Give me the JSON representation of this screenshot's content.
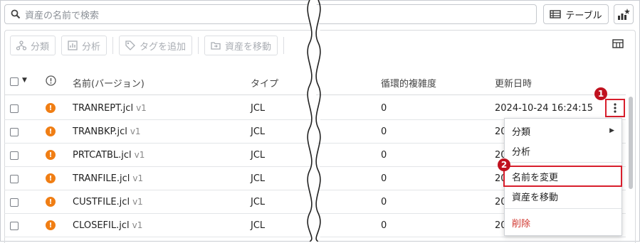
{
  "search": {
    "placeholder": "資産の名前で検索"
  },
  "header_buttons": {
    "table_label": "テーブル"
  },
  "toolbar": [
    {
      "label": "分類",
      "icon": "classify-icon"
    },
    {
      "label": "分析",
      "icon": "analyze-icon"
    },
    {
      "label": "タグを追加",
      "icon": "tag-icon"
    },
    {
      "label": "資産を移動",
      "icon": "move-icon"
    }
  ],
  "columns": {
    "name": "名前(バージョン)",
    "type": "タイプ",
    "complexity": "循環的複雑度",
    "updated": "更新日時"
  },
  "rows": [
    {
      "name": "TRANREPT.jcl",
      "version": "v1",
      "type": "JCL",
      "complexity": "0",
      "updated": "2024-10-24 16:24:15"
    },
    {
      "name": "TRANBKP.jcl",
      "version": "v1",
      "type": "JCL",
      "complexity": "0",
      "updated": "202"
    },
    {
      "name": "PRTCATBL.jcl",
      "version": "v1",
      "type": "JCL",
      "complexity": "0",
      "updated": "202"
    },
    {
      "name": "TRANFILE.jcl",
      "version": "v1",
      "type": "JCL",
      "complexity": "0",
      "updated": "202"
    },
    {
      "name": "CUSTFILE.jcl",
      "version": "v1",
      "type": "JCL",
      "complexity": "0",
      "updated": "202"
    },
    {
      "name": "CLOSEFIL.jcl",
      "version": "v1",
      "type": "JCL",
      "complexity": "0",
      "updated": "202"
    }
  ],
  "menu": {
    "classify": "分類",
    "analyze": "分析",
    "rename": "名前を変更",
    "move": "資産を移動",
    "delete": "削除"
  },
  "markers": {
    "one": "1",
    "two": "2"
  },
  "colors": {
    "warning": "#f07e14",
    "highlight": "#d81e2c",
    "delete": "#d0342c"
  }
}
